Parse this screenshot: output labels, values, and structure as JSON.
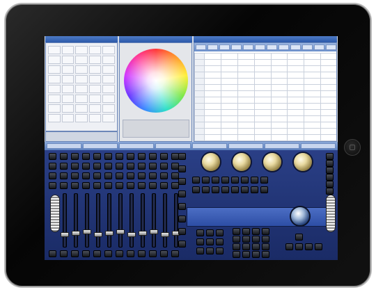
{
  "app": {
    "fixtures_title": "",
    "color_title": "",
    "sheet_title": ""
  },
  "sheet_toolbar": [
    "",
    "",
    "",
    "",
    "",
    "",
    "",
    "",
    "",
    "",
    "",
    ""
  ],
  "status_bar": [
    "",
    "",
    "",
    "",
    "",
    "",
    "",
    ""
  ],
  "colors": {
    "console_blue": "#2a3f86",
    "window_blue": "#2b58a9",
    "knob_gold": "#e8d9a0",
    "bezel_black": "#0a0a0a"
  },
  "icons": {
    "home_button": "home-button-icon",
    "trackball": "trackball-icon",
    "color_wheel": "color-wheel"
  }
}
